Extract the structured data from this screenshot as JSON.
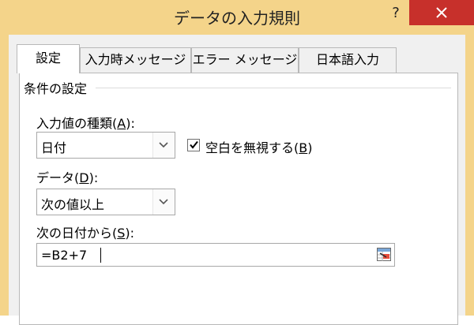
{
  "window": {
    "title": "データの入力規則",
    "help_label": "?"
  },
  "tabs": [
    {
      "label": "設定",
      "active": true
    },
    {
      "label": "入力時メッセージ",
      "active": false
    },
    {
      "label": "エラー メッセージ",
      "active": false
    },
    {
      "label": "日本語入力",
      "active": false
    }
  ],
  "settings": {
    "group_label": "条件の設定",
    "allow": {
      "label_text": "入力値の種類(",
      "label_key": "A",
      "label_end": "):",
      "value": "日付"
    },
    "ignore_blank": {
      "label_text": "空白を無視する(",
      "label_key": "B",
      "label_end": ")",
      "checked": true
    },
    "data": {
      "label_text": "データ(",
      "label_key": "D",
      "label_end": "):",
      "value": "次の値以上"
    },
    "start_date": {
      "label_text": "次の日付から(",
      "label_key": "S",
      "label_end": "):",
      "value": "=B2+7"
    }
  },
  "colors": {
    "frame": "#f4d48a",
    "close": "#c7302b",
    "panel": "#ffffff",
    "client": "#f0f0f0"
  }
}
